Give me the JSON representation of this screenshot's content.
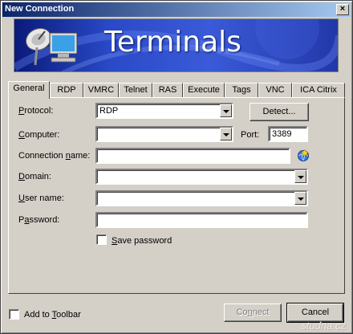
{
  "window": {
    "title": "New Connection",
    "close_glyph": "×"
  },
  "banner": {
    "text": "Terminals",
    "icon": "satellite-computer-icon"
  },
  "tabs": [
    {
      "label": "General",
      "active": true
    },
    {
      "label": "RDP"
    },
    {
      "label": "VMRC"
    },
    {
      "label": "Telnet"
    },
    {
      "label": "RAS"
    },
    {
      "label": "Execute"
    },
    {
      "label": "Tags"
    },
    {
      "label": "VNC"
    },
    {
      "label": "ICA Citrix"
    }
  ],
  "form": {
    "protocol": {
      "label_pre": "",
      "label_u": "P",
      "label_post": "rotocol:",
      "value": "RDP"
    },
    "detect_button": "Detect...",
    "computer": {
      "label_pre": "",
      "label_u": "C",
      "label_post": "omputer:",
      "value": ""
    },
    "port": {
      "label": "Port:",
      "value": "3389"
    },
    "connection_name": {
      "label_pre": "Connection ",
      "label_u": "n",
      "label_post": "ame:",
      "value": ""
    },
    "domain": {
      "label_pre": "",
      "label_u": "D",
      "label_post": "omain:",
      "value": ""
    },
    "user_name": {
      "label_pre": "",
      "label_u": "U",
      "label_post": "ser name:",
      "value": ""
    },
    "password": {
      "label_pre": "P",
      "label_u": "a",
      "label_post": "ssword:",
      "value": ""
    },
    "save_password": {
      "label_pre": "",
      "label_u": "S",
      "label_post": "ave password",
      "checked": false
    }
  },
  "footer": {
    "add_to_toolbar": {
      "label_pre": "Add to ",
      "label_u": "T",
      "label_post": "oolbar",
      "checked": false
    },
    "connect_pre": "Co",
    "connect_u": "n",
    "connect_post": "nect",
    "cancel": "Cancel"
  },
  "watermark": "studna.cz"
}
